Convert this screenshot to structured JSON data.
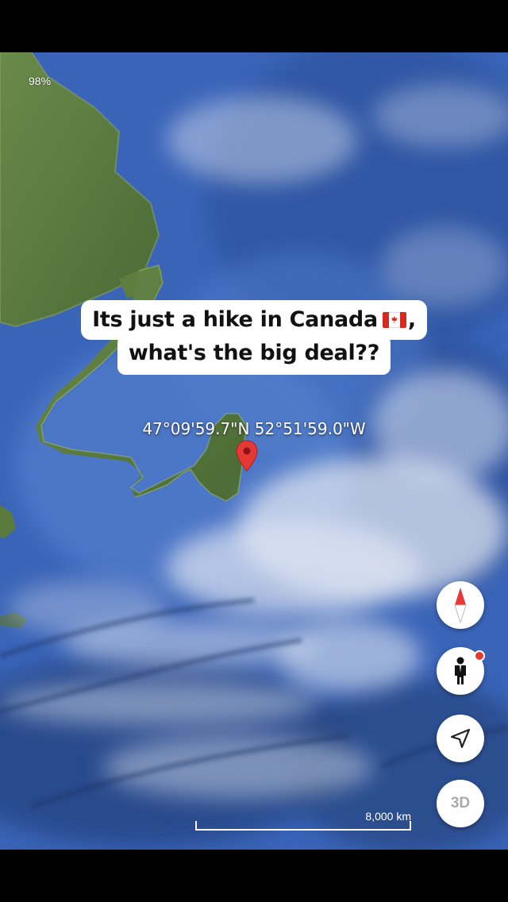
{
  "status": {
    "zoom_percent": "98%"
  },
  "caption": {
    "line1": "Its just a hike in Canada",
    "line1_suffix": ",",
    "line2": "what's the big deal??",
    "flag_icon": "canada-flag-icon"
  },
  "location": {
    "coordinates": "47°09'59.7\"N 52°51'59.0\"W",
    "pin_icon": "map-pin-icon",
    "pin_color": "#e53935"
  },
  "controls": {
    "compass_icon": "compass-icon",
    "street_view_icon": "pegman-icon",
    "locate_icon": "navigation-arrow-icon",
    "three_d_label": "3D"
  },
  "scale_bar": {
    "label": "8,000 km"
  },
  "colors": {
    "ocean": "#3a63b6",
    "land": "#5a7a3e",
    "caption_bg": "#ffffff"
  }
}
